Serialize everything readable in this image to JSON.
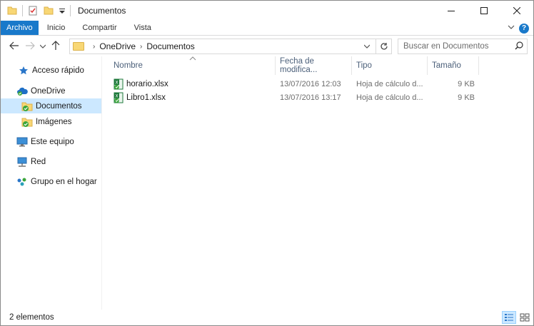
{
  "window": {
    "title": "Documentos"
  },
  "ribbon": {
    "tabs": [
      "Archivo",
      "Inicio",
      "Compartir",
      "Vista"
    ]
  },
  "address": {
    "crumbs": [
      "OneDrive",
      "Documentos"
    ]
  },
  "search": {
    "placeholder": "Buscar en Documentos"
  },
  "sidebar": {
    "items": [
      {
        "label": "Acceso rápido",
        "icon": "star-icon"
      },
      {
        "label": "OneDrive",
        "icon": "onedrive-cloud-icon"
      },
      {
        "label": "Documentos",
        "icon": "synced-folder-icon",
        "selected": true
      },
      {
        "label": "Imágenes",
        "icon": "synced-folder-icon"
      },
      {
        "label": "Este equipo",
        "icon": "computer-icon"
      },
      {
        "label": "Red",
        "icon": "network-icon"
      },
      {
        "label": "Grupo en el hogar",
        "icon": "homegroup-icon"
      }
    ]
  },
  "columns": [
    "Nombre",
    "Fecha de modifica...",
    "Tipo",
    "Tamaño"
  ],
  "files": [
    {
      "name": "horario.xlsx",
      "date": "13/07/2016 12:03",
      "type": "Hoja de cálculo d...",
      "size": "9 KB"
    },
    {
      "name": "Libro1.xlsx",
      "date": "13/07/2016 13:17",
      "type": "Hoja de cálculo d...",
      "size": "9 KB"
    }
  ],
  "status": {
    "count": "2 elementos"
  },
  "colors": {
    "accent": "#1979ca",
    "selection": "#cce8ff",
    "folder": "#f8d775",
    "excel": "#1f7a3d",
    "sync": "#3aa53a"
  }
}
